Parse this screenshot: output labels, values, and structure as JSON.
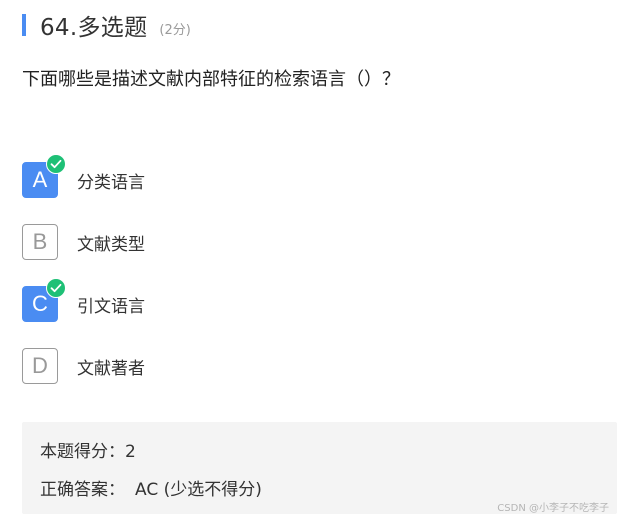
{
  "question": {
    "number_type": "64.多选题",
    "score": "(2分)",
    "text": "下面哪些是描述文献内部特征的检索语言（）？"
  },
  "options": [
    {
      "letter": "A",
      "label": "分类语言",
      "selected": true
    },
    {
      "letter": "B",
      "label": "文献类型",
      "selected": false
    },
    {
      "letter": "C",
      "label": "引文语言",
      "selected": true
    },
    {
      "letter": "D",
      "label": "文献著者",
      "selected": false
    }
  ],
  "result": {
    "score_label": "本题得分：",
    "score_value": "2",
    "answer_label": "正确答案：",
    "answer_value": "AC (少选不得分)"
  },
  "watermark": "CSDN @小李子不吃李子",
  "colors": {
    "accent": "#4a8cf2",
    "check": "#1ec076",
    "panel": "#f4f4f4"
  }
}
